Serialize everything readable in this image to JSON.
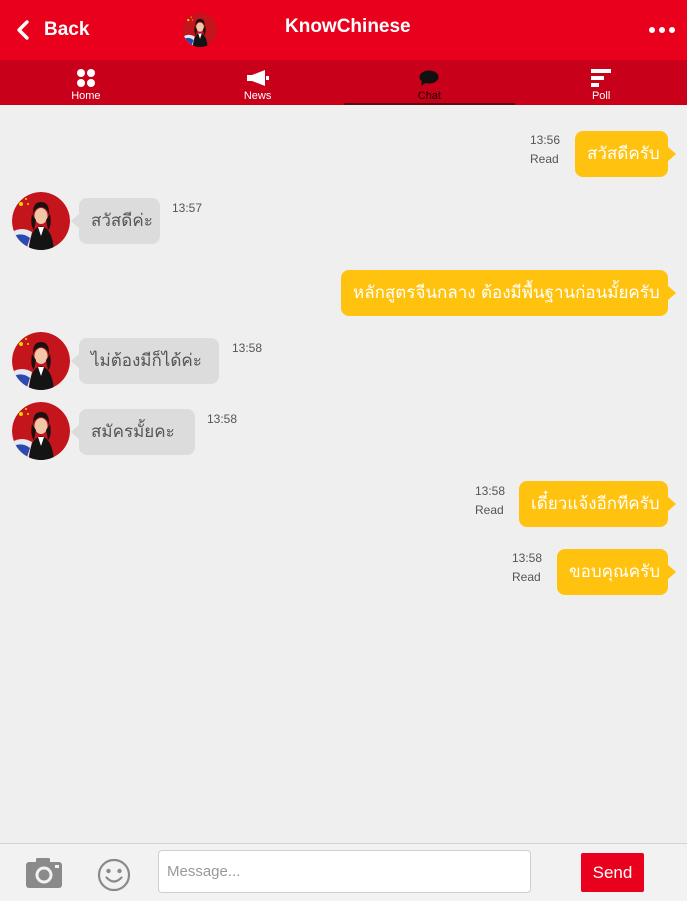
{
  "header": {
    "back_label": "Back",
    "title": "KnowChinese",
    "bg_color": "#e8001c"
  },
  "tabs": [
    {
      "label": "Home",
      "icon": "grid-icon"
    },
    {
      "label": "News",
      "icon": "megaphone-icon"
    },
    {
      "label": "Chat",
      "icon": "chat-bubble-icon",
      "active": true
    },
    {
      "label": "Poll",
      "icon": "poll-icon"
    }
  ],
  "messages": [
    {
      "direction": "out",
      "text": "สวัสดีครับ",
      "time": "13:56",
      "status": "Read"
    },
    {
      "direction": "in",
      "text": "สวัสดีค่ะ",
      "time": "13:57"
    },
    {
      "direction": "out",
      "text": "หลักสูตรจีนกลาง ต้องมีพื้นฐานก่อนมั้ยครับ"
    },
    {
      "direction": "in",
      "text": "ไม่ต้องมีก็ได้ค่ะ",
      "time": "13:58"
    },
    {
      "direction": "in",
      "text": "สมัครมั้ยคะ",
      "time": "13:58"
    },
    {
      "direction": "out",
      "text": "เดี๋ยวแจ้งอีกทีครับ",
      "time": "13:58",
      "status": "Read"
    },
    {
      "direction": "out",
      "text": "ขอบคุณครับ",
      "time": "13:58",
      "status": "Read"
    }
  ],
  "composer": {
    "placeholder": "Message...",
    "send_label": "Send"
  },
  "colors": {
    "outgoing_bubble": "#ffc20e",
    "incoming_bubble": "#dcdcdc",
    "accent": "#e8001c"
  }
}
